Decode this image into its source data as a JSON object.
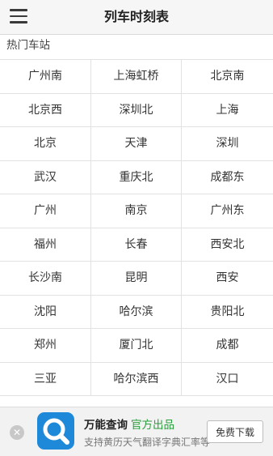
{
  "header": {
    "title": "列车时刻表",
    "menu_icon": "hamburger-menu-icon"
  },
  "section": {
    "label": "热门车站"
  },
  "stations": [
    "广州南",
    "上海虹桥",
    "北京南",
    "北京西",
    "深圳北",
    "上海",
    "北京",
    "天津",
    "深圳",
    "武汉",
    "重庆北",
    "成都东",
    "广州",
    "南京",
    "广州东",
    "福州",
    "长春",
    "西安北",
    "长沙南",
    "昆明",
    "西安",
    "沈阳",
    "哈尔滨",
    "贵阳北",
    "郑州",
    "厦门北",
    "成都",
    "三亚",
    "哈尔滨西",
    "汉口"
  ],
  "ad": {
    "close_symbol": "✕",
    "app_icon": "magnifier-app-icon",
    "app_name": "万能查询",
    "tag": "官方出品",
    "description": "支持黄历天气翻译字典汇率等",
    "download_label": "免费下载",
    "colors": {
      "icon_bg": "#1e88d9",
      "tag": "#2a9d3c"
    }
  }
}
